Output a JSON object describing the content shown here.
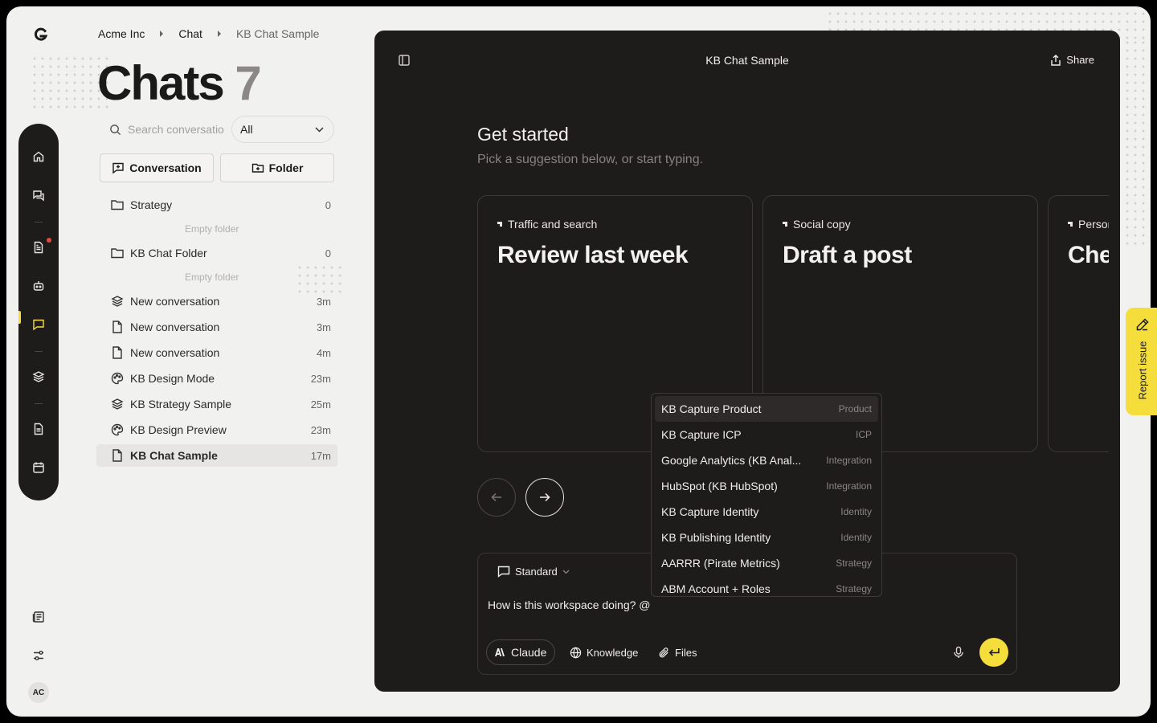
{
  "breadcrumb": [
    "Acme Inc",
    "Chat",
    "KB Chat Sample"
  ],
  "page": {
    "title": "Chats",
    "count": "7"
  },
  "search": {
    "placeholder": "Search conversations"
  },
  "filter": {
    "value": "All"
  },
  "actions": {
    "conversation": "Conversation",
    "folder": "Folder"
  },
  "folders": [
    {
      "name": "Strategy",
      "count": "0",
      "empty_label": "Empty folder"
    },
    {
      "name": "KB Chat Folder",
      "count": "0",
      "empty_label": "Empty folder"
    }
  ],
  "conversations": [
    {
      "name": "New conversation",
      "time": "3m",
      "icon": "layers-icon"
    },
    {
      "name": "New conversation",
      "time": "3m",
      "icon": "document-icon"
    },
    {
      "name": "New conversation",
      "time": "4m",
      "icon": "document-icon"
    },
    {
      "name": "KB Design Mode",
      "time": "23m",
      "icon": "palette-icon"
    },
    {
      "name": "KB Strategy Sample",
      "time": "25m",
      "icon": "layers-icon"
    },
    {
      "name": "KB Design Preview",
      "time": "23m",
      "icon": "palette-icon"
    },
    {
      "name": "KB Chat Sample",
      "time": "17m",
      "icon": "document-icon",
      "active": true
    }
  ],
  "user": {
    "initials": "AC"
  },
  "panel": {
    "title": "KB Chat Sample",
    "share": "Share"
  },
  "get_started": {
    "title": "Get started",
    "subtitle": "Pick a suggestion below, or start typing."
  },
  "suggestions": [
    {
      "category": "Traffic and search",
      "title": "Review last week"
    },
    {
      "category": "Social copy",
      "title": "Draft a post"
    },
    {
      "category": "Persona",
      "title": "Check"
    }
  ],
  "composer": {
    "mode": "Standard",
    "text": "How is this workspace doing? @",
    "model": "Claude",
    "knowledge": "Knowledge",
    "files": "Files"
  },
  "mentions": [
    {
      "name": "KB Capture Product",
      "type": "Product",
      "selected": true
    },
    {
      "name": "KB Capture ICP",
      "type": "ICP"
    },
    {
      "name": "Google Analytics (KB Anal...",
      "type": "Integration"
    },
    {
      "name": "HubSpot (KB HubSpot)",
      "type": "Integration"
    },
    {
      "name": "KB Capture Identity",
      "type": "Identity"
    },
    {
      "name": "KB Publishing Identity",
      "type": "Identity"
    },
    {
      "name": "AARRR (Pirate Metrics)",
      "type": "Strategy"
    },
    {
      "name": "ABM Account + Roles",
      "type": "Strategy"
    }
  ],
  "report": {
    "label": "Report issue"
  },
  "colors": {
    "accent": "#f5dd3b",
    "panel": "#1e1b1b",
    "app_bg": "#f1f1f0",
    "notification": "#e5483f"
  }
}
